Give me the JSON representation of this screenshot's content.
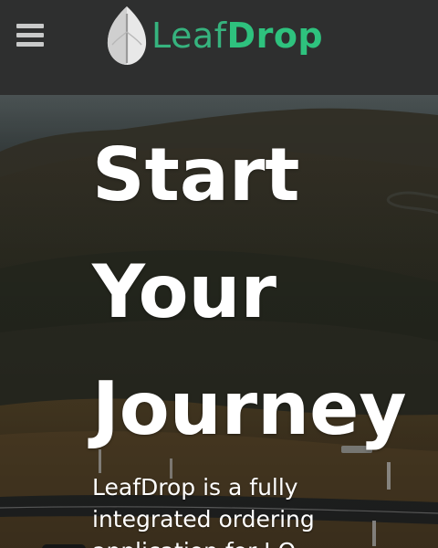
{
  "header": {
    "brand_light": "Leaf",
    "brand_bold": "Drop"
  },
  "hero": {
    "title_lines": [
      "Start",
      "Your",
      "Journey"
    ],
    "description_lines": [
      "LeafDrop is a fully",
      "integrated ordering",
      "application for I O..."
    ]
  },
  "colors": {
    "brand_green": "#2ec27e",
    "header_bg": "#2e2f2f",
    "hero_text": "#ffffff"
  },
  "icons": {
    "menu": "hamburger-menu-icon",
    "logo": "leaf-logo-icon"
  }
}
